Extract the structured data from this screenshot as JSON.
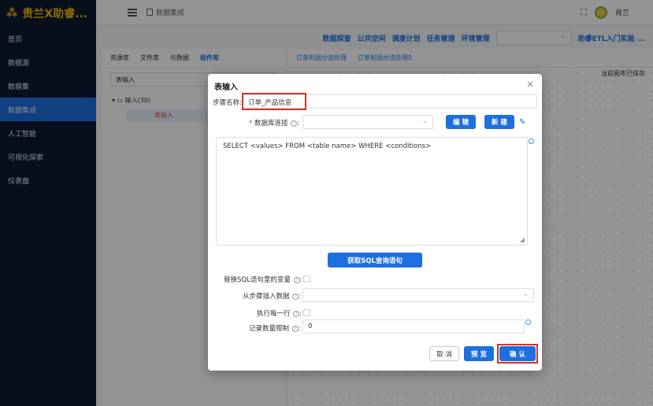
{
  "app": {
    "title": "贵兰X助睿..."
  },
  "sidebar": {
    "items": [
      {
        "label": "首页",
        "active": false
      },
      {
        "label": "数据源",
        "active": false
      },
      {
        "label": "数据集",
        "active": false
      },
      {
        "label": "数据集成",
        "active": true
      },
      {
        "label": "人工智能",
        "active": false
      },
      {
        "label": "可视化探索",
        "active": false
      },
      {
        "label": "仪表盘",
        "active": false
      }
    ]
  },
  "topbar": {
    "breadcrumb": "数据集成",
    "username": "肖兰",
    "expand_icon": "⛶"
  },
  "workspace": {
    "menu": [
      "数据探查",
      "公共空间",
      "调度计划",
      "任务管理",
      "环境管理"
    ],
    "guide_link": "助睿ETL入门实验 ...",
    "left_tabs": [
      "资源库",
      "文件库",
      "元数据",
      "组件库"
    ],
    "left_active_tab": "组件库",
    "left_search": "表输入",
    "tree_root": "输入(30)",
    "tree_child": "表输入",
    "canvas_tabs": [
      "订单利润分流处理",
      "订单利润分流处理5"
    ],
    "canvas_status": "当前画布已保存"
  },
  "modal": {
    "title": "表输入",
    "close": "×",
    "step_name_label": "步骤名称",
    "step_name_value": "订单_产品信息",
    "db_conn_label": "数据库连接",
    "edit_button": "编 辑",
    "new_button": "新 建",
    "sql_text": "SELECT <values> FROM <table name> WHERE <conditions>",
    "get_sql_button": "获取SQL查询语句",
    "replace_vars_label": "替换SQL语句里的变量",
    "insert_from_step_label": "从步骤插入数据",
    "exec_each_row_label": "执行每一行",
    "limit_label": "记录数量限制",
    "limit_value": "0",
    "cancel_button": "取 消",
    "preview_button": "预 览",
    "confirm_button": "确 认"
  },
  "colors": {
    "primary": "#1e6fe0",
    "sidebar_bg": "#0d1b33",
    "highlight": "#d93025"
  }
}
